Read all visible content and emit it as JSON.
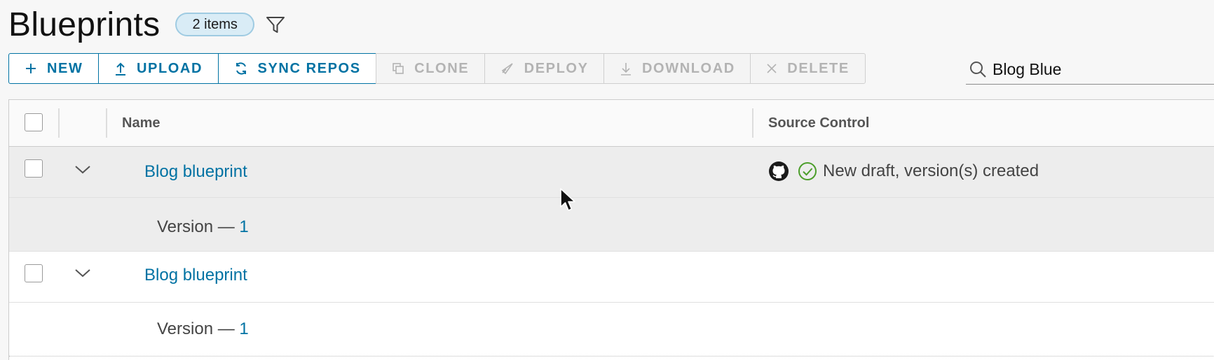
{
  "page": {
    "title": "Blueprints",
    "count_badge": "2 items",
    "filter_icon": "filter-icon"
  },
  "toolbar": {
    "new_label": "NEW",
    "upload_label": "UPLOAD",
    "sync_label": "SYNC REPOS",
    "clone_label": "CLONE",
    "deploy_label": "DEPLOY",
    "download_label": "DOWNLOAD",
    "delete_label": "DELETE"
  },
  "search": {
    "value": "Blog Blue",
    "icon": "search-icon"
  },
  "table": {
    "columns": [
      "Name",
      "Source Control"
    ],
    "rows": [
      {
        "name": "Blog blueprint",
        "selected": true,
        "source_text": "New draft, version(s) created",
        "source_icons": [
          "github-icon",
          "check-circle-icon"
        ],
        "version_prefix": "Version — ",
        "version_number": "1"
      },
      {
        "name": "Blog blueprint",
        "selected": false,
        "source_text": "",
        "version_prefix": "Version — ",
        "version_number": "1"
      }
    ]
  },
  "colors": {
    "accent": "#0072a3",
    "badge_bg": "#d9ecf6",
    "selected_row": "#ededed",
    "success": "#4c9e2b",
    "disabled": "#b3b3b3"
  }
}
